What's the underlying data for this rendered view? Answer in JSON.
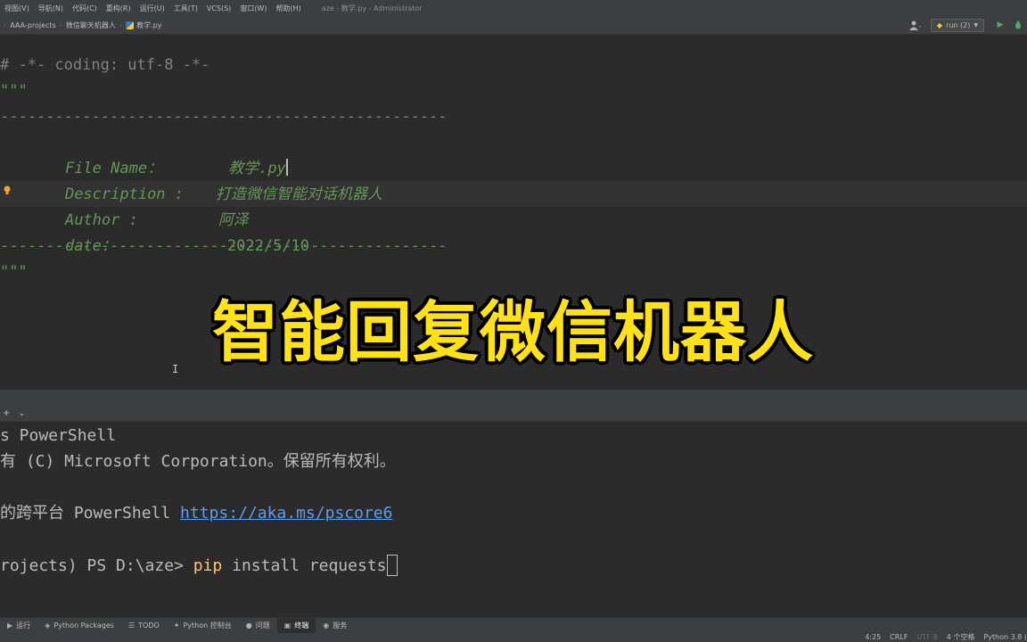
{
  "menubar": {
    "items": [
      "视图(V)",
      "导航(N)",
      "代码(C)",
      "重构(R)",
      "运行(U)",
      "工具(T)",
      "VCS(S)",
      "窗口(W)",
      "帮助(H)"
    ],
    "window_title": "aze - 教学.py - Administrator"
  },
  "navbar": {
    "breadcrumbs": [
      "AAA-projects",
      "微信聊天机器人",
      "教学.py"
    ],
    "run_config": "run (2)"
  },
  "editor": {
    "lines": {
      "coding": "# -*- coding: utf-8 -*-",
      "doc_open": "\"\"\"",
      "rule_top": "-------------------------------------------------",
      "file_name_label": "File Name：",
      "file_name_value": "教学.py",
      "description_label": "Description :",
      "description_value": "打造微信智能对话机器人",
      "author_label": "Author :",
      "author_value": "阿泽",
      "date_label": "date：",
      "date_value": "2022/5/10",
      "rule_bottom": "-------------------------------------------------",
      "doc_close": "\"\"\""
    }
  },
  "caption": "智能回复微信机器人",
  "terminal": {
    "tab_add": "+",
    "tab_dropdown": "⌄",
    "line1": "s PowerShell",
    "line2": "有 (C) Microsoft Corporation。保留所有权利。",
    "line3_text": "的跨平台 PowerShell ",
    "line3_link": "https://aka.ms/pscore6",
    "line4_prompt": "rojects) PS D:\\aze> ",
    "line4_cmd": "pip",
    "line4_args": " install requests"
  },
  "tool_tabs": [
    {
      "icon": "▶",
      "label": "运行"
    },
    {
      "icon": "◈",
      "label": "Python Packages"
    },
    {
      "icon": "☰",
      "label": "TODO"
    },
    {
      "icon": "✦",
      "label": "Python 控制台"
    },
    {
      "icon": "●",
      "label": "问题"
    },
    {
      "icon": "▣",
      "label": "终端"
    },
    {
      "icon": "◉",
      "label": "服务"
    }
  ],
  "statusbar": {
    "position": "4:25",
    "line_sep": "CRLF",
    "encoding": "UTF-8",
    "indent": "4 个空格",
    "interpreter": "Python 3.8 ("
  }
}
